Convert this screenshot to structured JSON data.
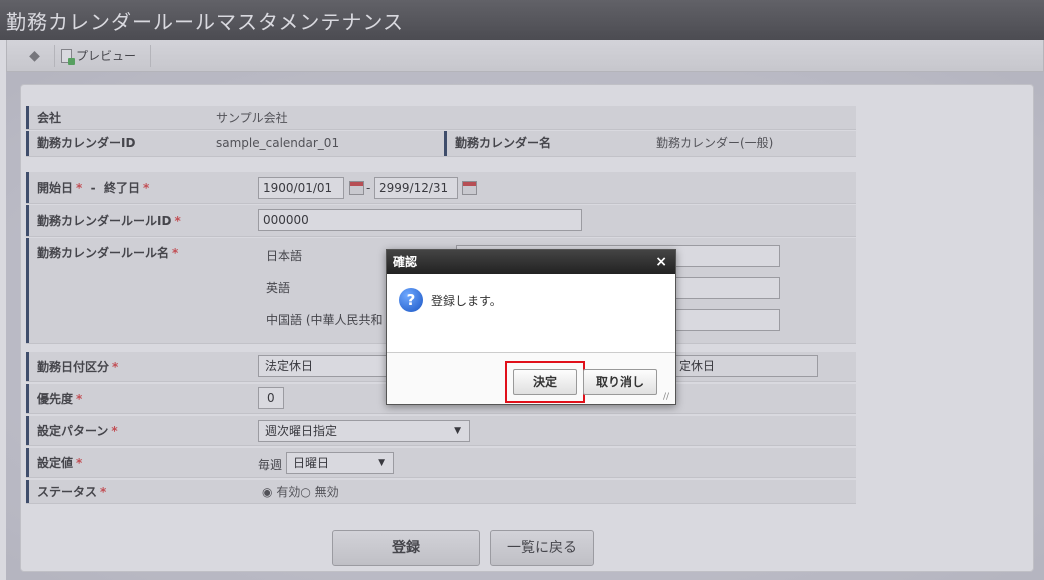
{
  "window": {
    "title": "勤務カレンダールールマスタメンテナンス"
  },
  "toolbar": {
    "back_icon": "back-arrow-icon",
    "preview_label": "プレビュー"
  },
  "form": {
    "company": {
      "label": "会社",
      "value": "サンプル会社"
    },
    "calendar_id": {
      "label": "勤務カレンダーID",
      "value": "sample_calendar_01"
    },
    "calendar_name": {
      "label": "勤務カレンダー名",
      "value": "勤務カレンダー(一般)"
    },
    "period": {
      "label_start": "開始日",
      "separator": "-",
      "label_end": "終了日",
      "start": "1900/01/01",
      "dash": "-",
      "end": "2999/12/31"
    },
    "rule_id": {
      "label": "勤務カレンダールールID",
      "value": "000000"
    },
    "rule_name": {
      "label": "勤務カレンダールール名",
      "langs": [
        "日本語",
        "英語",
        "中国語 (中華人民共和"
      ]
    },
    "date_type": {
      "label": "勤務日付区分",
      "value": "法定休日",
      "value2": "定休日"
    },
    "priority": {
      "label": "優先度",
      "value": "0"
    },
    "pattern": {
      "label": "設定パターン",
      "value": "週次曜日指定"
    },
    "setting": {
      "label": "設定値",
      "prefix": "毎週",
      "value": "日曜日"
    },
    "status": {
      "label": "ステータス",
      "options": [
        "有効",
        "無効"
      ],
      "selected": "有効"
    },
    "required_mark": "*"
  },
  "buttons": {
    "register": "登録",
    "back_to_list": "一覧に戻る"
  },
  "dialog": {
    "title": "確認",
    "close": "×",
    "message": "登録します。",
    "ok": "決定",
    "cancel": "取り消し"
  }
}
